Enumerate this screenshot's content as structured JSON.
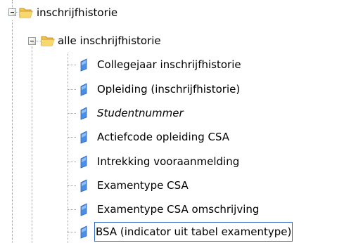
{
  "tree": {
    "root": {
      "label": "inschrijfhistorie",
      "icon": "open-folder-icon",
      "expanded": true,
      "children": [
        {
          "label": "alle inschrijfhistorie",
          "icon": "open-folder-icon",
          "expanded": true,
          "items": [
            {
              "label": "Collegejaar inschrijfhistorie",
              "icon": "field-icon",
              "italic": false,
              "selected": false
            },
            {
              "label": "Opleiding (inschrijfhistorie)",
              "icon": "field-icon",
              "italic": false,
              "selected": false
            },
            {
              "label": "Studentnummer",
              "icon": "field-icon",
              "italic": true,
              "selected": false
            },
            {
              "label": "Actiefcode opleiding CSA",
              "icon": "field-icon",
              "italic": false,
              "selected": false
            },
            {
              "label": "Intrekking vooraanmelding",
              "icon": "field-icon",
              "italic": false,
              "selected": false
            },
            {
              "label": "Examentype CSA",
              "icon": "field-icon",
              "italic": false,
              "selected": false
            },
            {
              "label": "Examentype CSA omschrijving",
              "icon": "field-icon",
              "italic": false,
              "selected": false
            },
            {
              "label": "BSA (indicator uit tabel examentype)",
              "icon": "field-icon",
              "italic": false,
              "selected": true
            }
          ]
        }
      ]
    }
  },
  "colors": {
    "folder_fill": "#f7d96b",
    "folder_dark": "#d9a92b",
    "field_blue": "#4a8ee6",
    "selection_border": "#316ac5",
    "connector": "#a0a0a0"
  }
}
